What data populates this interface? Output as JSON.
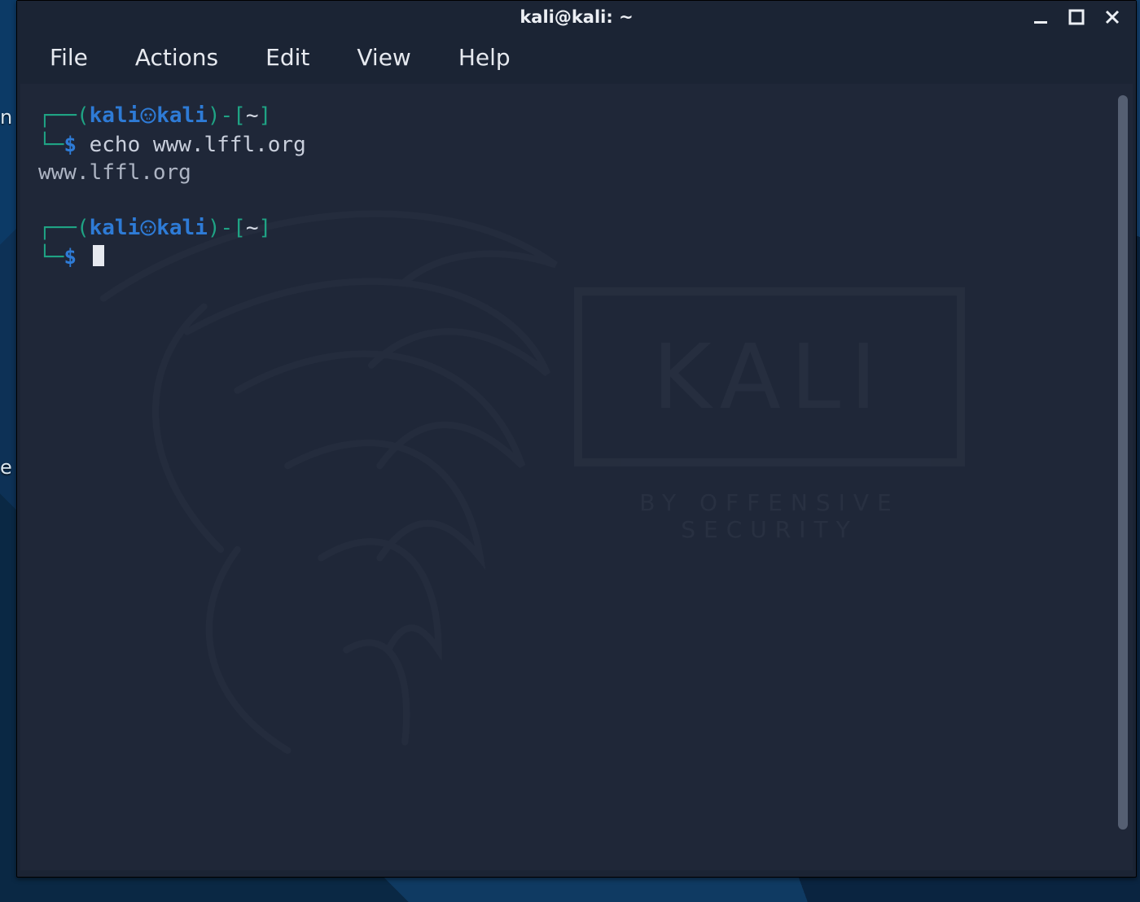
{
  "desktop": {
    "icon_fragment_1": "n",
    "icon_fragment_2": "e"
  },
  "window": {
    "title": "kali@kali: ~"
  },
  "menubar": {
    "items": [
      "File",
      "Actions",
      "Edit",
      "View",
      "Help"
    ]
  },
  "watermark": {
    "logo_text": "KALI",
    "tagline": "BY OFFENSIVE SECURITY"
  },
  "terminal": {
    "blocks": [
      {
        "user": "kali",
        "separator_icon": "skull",
        "host": "kali",
        "cwd": "~",
        "prompt_symbol": "$",
        "command": "echo www.lffl.org",
        "output": "www.lffl.org"
      },
      {
        "user": "kali",
        "separator_icon": "skull",
        "host": "kali",
        "cwd": "~",
        "prompt_symbol": "$",
        "command": "",
        "output": "",
        "cursor": true
      }
    ],
    "colors": {
      "prompt_bracket": "#1fa384",
      "user_host": "#2e7bd6",
      "cwd": "#d6dbe6",
      "text": "#c9cfdc"
    }
  }
}
